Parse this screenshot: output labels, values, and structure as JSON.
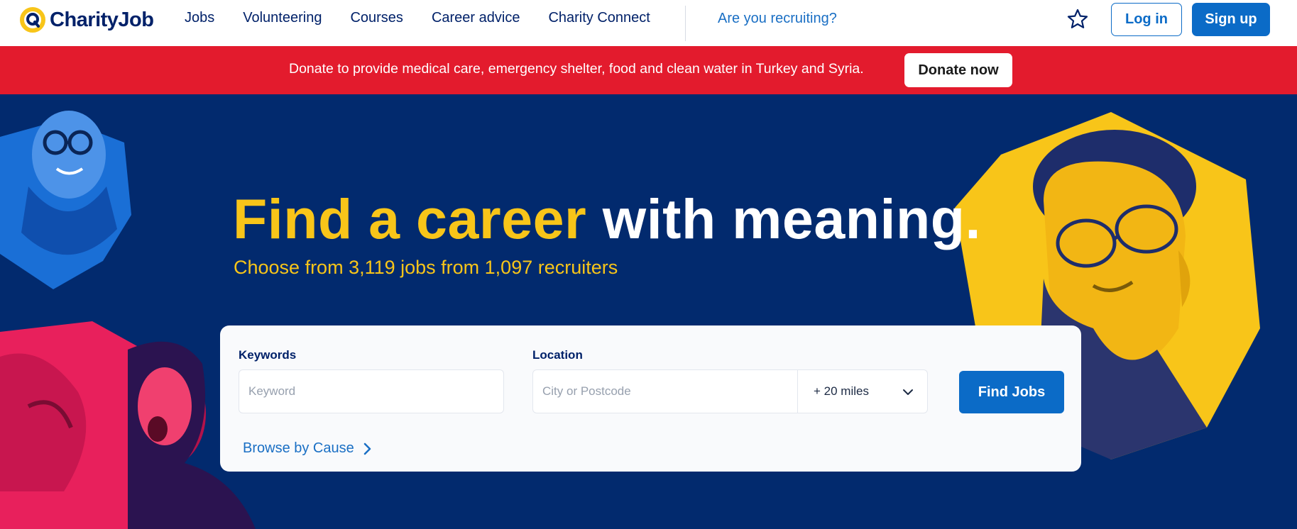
{
  "header": {
    "logo_text": "CharityJob",
    "nav": [
      "Jobs",
      "Volunteering",
      "Courses",
      "Career advice",
      "Charity Connect"
    ],
    "recruiting_link": "Are you recruiting?",
    "favourites_icon": "star-icon",
    "login_label": "Log in",
    "signup_label": "Sign up"
  },
  "banner": {
    "text": "Donate to provide medical care, emergency shelter, food and clean water in Turkey and Syria.",
    "donate_label": "Donate now"
  },
  "hero": {
    "headline_highlight": "Find a career",
    "headline_rest": "with meaning.",
    "subline": "Choose from 3,119 jobs from 1,097 recruiters"
  },
  "search": {
    "keywords_label": "Keywords",
    "keyword_placeholder": "Keyword",
    "location_label": "Location",
    "location_placeholder": "City or Postcode",
    "radius_value": "+ 20 miles",
    "find_label": "Find Jobs",
    "browse_label": "Browse by Cause"
  },
  "colors": {
    "navy": "#022a6e",
    "accent_blue": "#0b6bc7",
    "yellow": "#f8c519",
    "banner_red": "#e31b2d",
    "photo_pink": "#e8205c",
    "photo_blue": "#1a6fd6"
  }
}
